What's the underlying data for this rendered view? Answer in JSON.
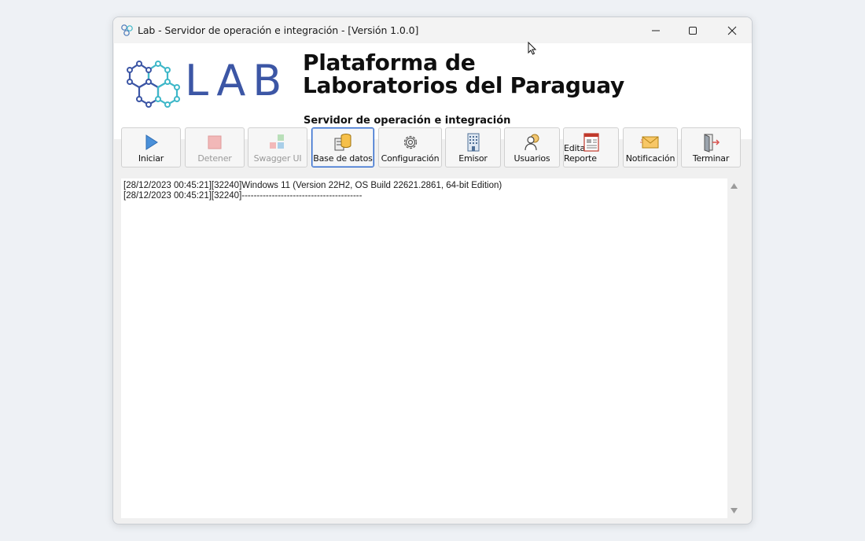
{
  "window": {
    "title": "Lab - Servidor de operación e integración - [Versión 1.0.0]",
    "controls": [
      "minimize",
      "maximize",
      "close"
    ]
  },
  "banner": {
    "logo_text": "LAB",
    "title_line1": "Plataforma de",
    "title_line2": "Laboratorios del Paraguay",
    "subtitle": "Servidor de operación e integración"
  },
  "toolbar": {
    "buttons": [
      {
        "label": "Iniciar",
        "icon": "play-icon",
        "enabled": true
      },
      {
        "label": "Detener",
        "icon": "stop-icon",
        "enabled": false
      },
      {
        "label": "Swagger UI",
        "icon": "blocks-icon",
        "enabled": false
      },
      {
        "label": "Base de datos",
        "icon": "database-icon",
        "enabled": true,
        "focused": true
      },
      {
        "label": "Configuración",
        "icon": "gear-icon",
        "enabled": true
      },
      {
        "label": "Emisor",
        "icon": "building-icon",
        "enabled": true
      },
      {
        "label": "Usuarios",
        "icon": "users-icon",
        "enabled": true
      },
      {
        "label": "Editar Reporte",
        "icon": "report-icon",
        "enabled": true
      },
      {
        "label": "Notificación",
        "icon": "envelope-icon",
        "enabled": true
      },
      {
        "label": "Terminar",
        "icon": "exit-door-icon",
        "enabled": true
      }
    ]
  },
  "log": {
    "lines": [
      "[28/12/2023 00:45:21][32240]Windows 11 (Version 22H2, OS Build 22621.2861, 64-bit Edition)",
      "[28/12/2023 00:45:21][32240]----------------------------------------"
    ]
  },
  "colors": {
    "logo_blue": "#3c56a5",
    "logo_teal": "#3fb8c9",
    "focus_border": "#2b65c8"
  }
}
